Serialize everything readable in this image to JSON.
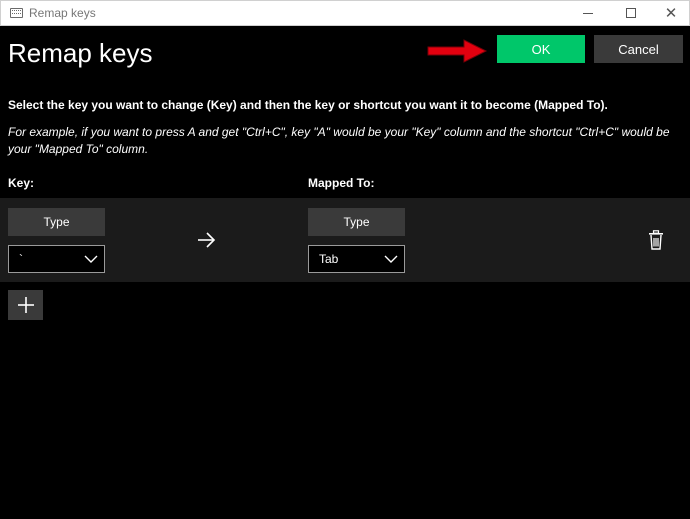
{
  "window": {
    "title": "Remap keys",
    "minimize_icon": "minimize-icon",
    "maximize_icon": "maximize-icon",
    "close_icon": "close-icon"
  },
  "header": {
    "title": "Remap keys",
    "ok_label": "OK",
    "cancel_label": "Cancel",
    "ok_color": "#00c76a",
    "annotation_color": "#e3000f"
  },
  "instructions": {
    "main": "Select the key you want to change (Key) and then the key or shortcut you want it to become (Mapped To).",
    "example": "For example, if you want to press A and get \"Ctrl+C\", key \"A\" would be your \"Key\" column and the shortcut \"Ctrl+C\" would be your \"Mapped To\" column."
  },
  "columns": {
    "key_label": "Key:",
    "mapped_label": "Mapped To:"
  },
  "mappings": [
    {
      "type_label": "Type",
      "key_value": "`",
      "mapped_type_label": "Type",
      "mapped_value": "Tab"
    }
  ],
  "icons": {
    "arrow": "arrow-right-icon",
    "delete": "trash-icon",
    "add": "plus-icon",
    "dropdown": "chevron-down-icon"
  }
}
